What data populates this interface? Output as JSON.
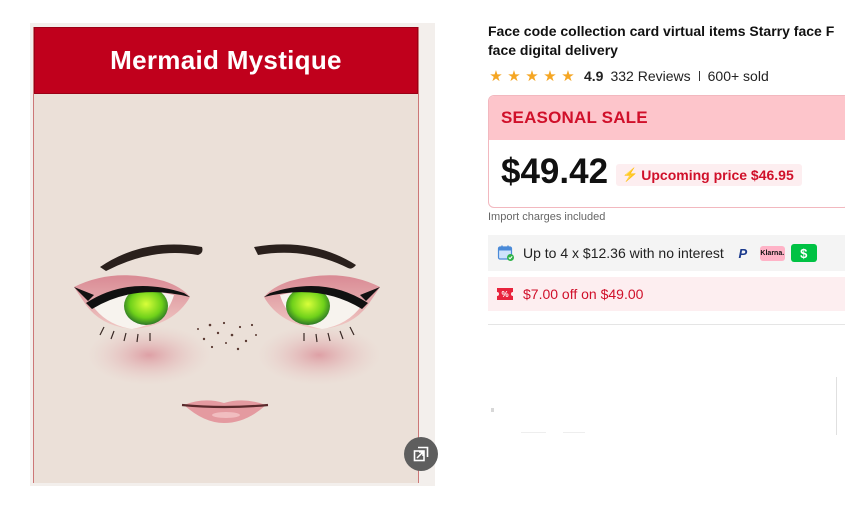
{
  "image": {
    "card_title": "Mermaid Mystique",
    "zoom_icon": "expand-icon"
  },
  "product": {
    "title_line1": "Face code collection card virtual items Starry face F",
    "title_line2": "face digital delivery",
    "rating": "4.9",
    "reviews": "332 Reviews",
    "sold": "600+ sold",
    "stars": 5
  },
  "sale": {
    "label": "SEASONAL SALE",
    "price": "$49.42",
    "upcoming": "Upcoming price $46.95",
    "import_note": "Import charges included"
  },
  "installments": {
    "text": "Up to 4 x $12.36 with no interest",
    "klarna_label": "Klarna.",
    "cashapp_label": "$"
  },
  "coupon": {
    "text": "$7.00 off on $49.00"
  },
  "colors": {
    "brand_red": "#c0001c",
    "sale_text": "#d0102a",
    "sale_bg": "#fdc5cb",
    "star": "#f5a623"
  }
}
